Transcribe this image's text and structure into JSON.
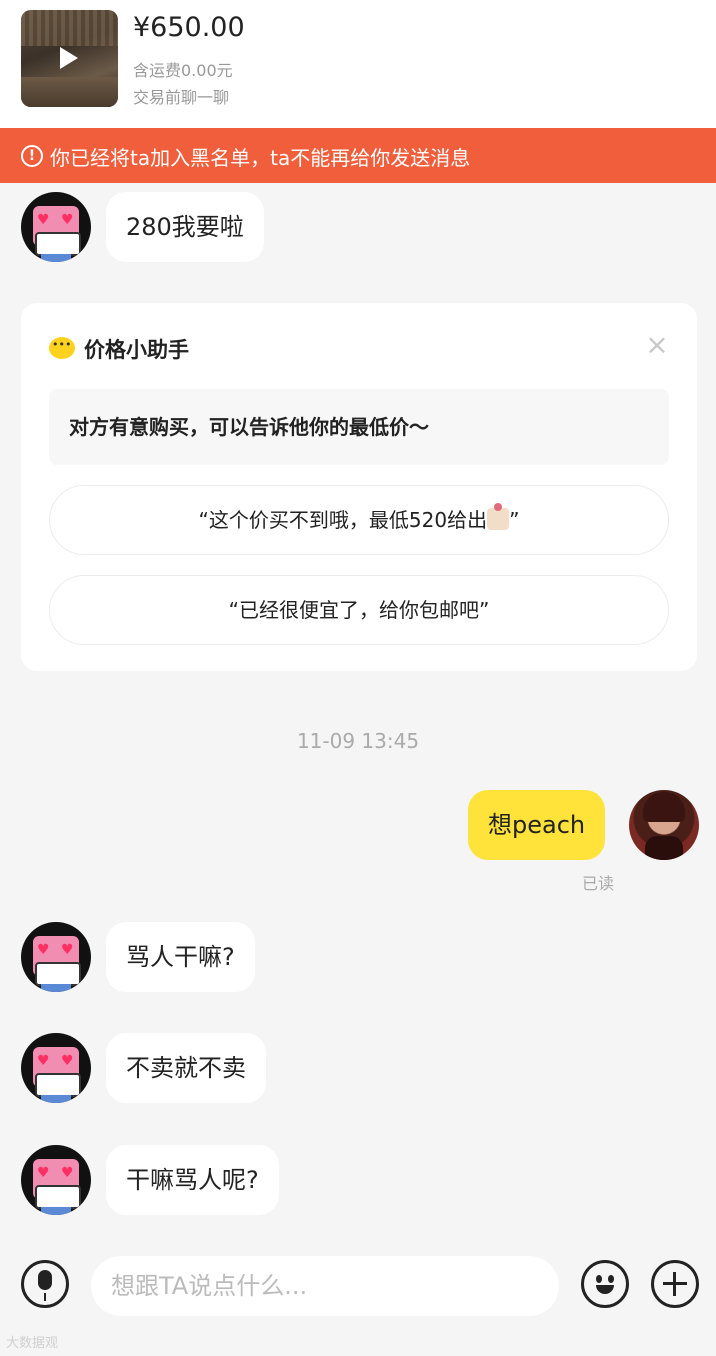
{
  "product": {
    "price": "¥650.00",
    "shipping": "含运费0.00元",
    "chat_before": "交易前聊一聊"
  },
  "banner": {
    "icon_text": "!",
    "text": "你已经将ta加入黑名单，ta不能再给你发送消息"
  },
  "messages": [
    {
      "side": "left",
      "text": "280我要啦"
    },
    {
      "side": "right",
      "text": "想peach",
      "status": "已读"
    },
    {
      "side": "left",
      "text": "骂人干嘛?"
    },
    {
      "side": "left",
      "text": "不卖就不卖"
    },
    {
      "side": "left",
      "text": "干嘛骂人呢?"
    }
  ],
  "timestamp": "11-09 13:45",
  "price_helper": {
    "title": "价格小助手",
    "close_symbol": "×",
    "tip": "对方有意购买，可以告诉他你的最低价～",
    "option_1": "“这个价买不到哦，最低520给出",
    "option_1_end": "”",
    "option_2": "“已经很便宜了，给你包邮吧”"
  },
  "input": {
    "placeholder": "想跟TA说点什么..."
  },
  "watermark": "大数据观",
  "icons": {
    "play": "play-icon",
    "warning": "warning-icon",
    "chat": "chat-bubble-icon",
    "close": "close-icon",
    "mic": "microphone-icon",
    "emoji": "smile-icon",
    "add": "plus-icon"
  },
  "colors": {
    "banner": "#f05e3c",
    "my_bubble": "#ffe23a",
    "helper_icon": "#ffd21f"
  }
}
